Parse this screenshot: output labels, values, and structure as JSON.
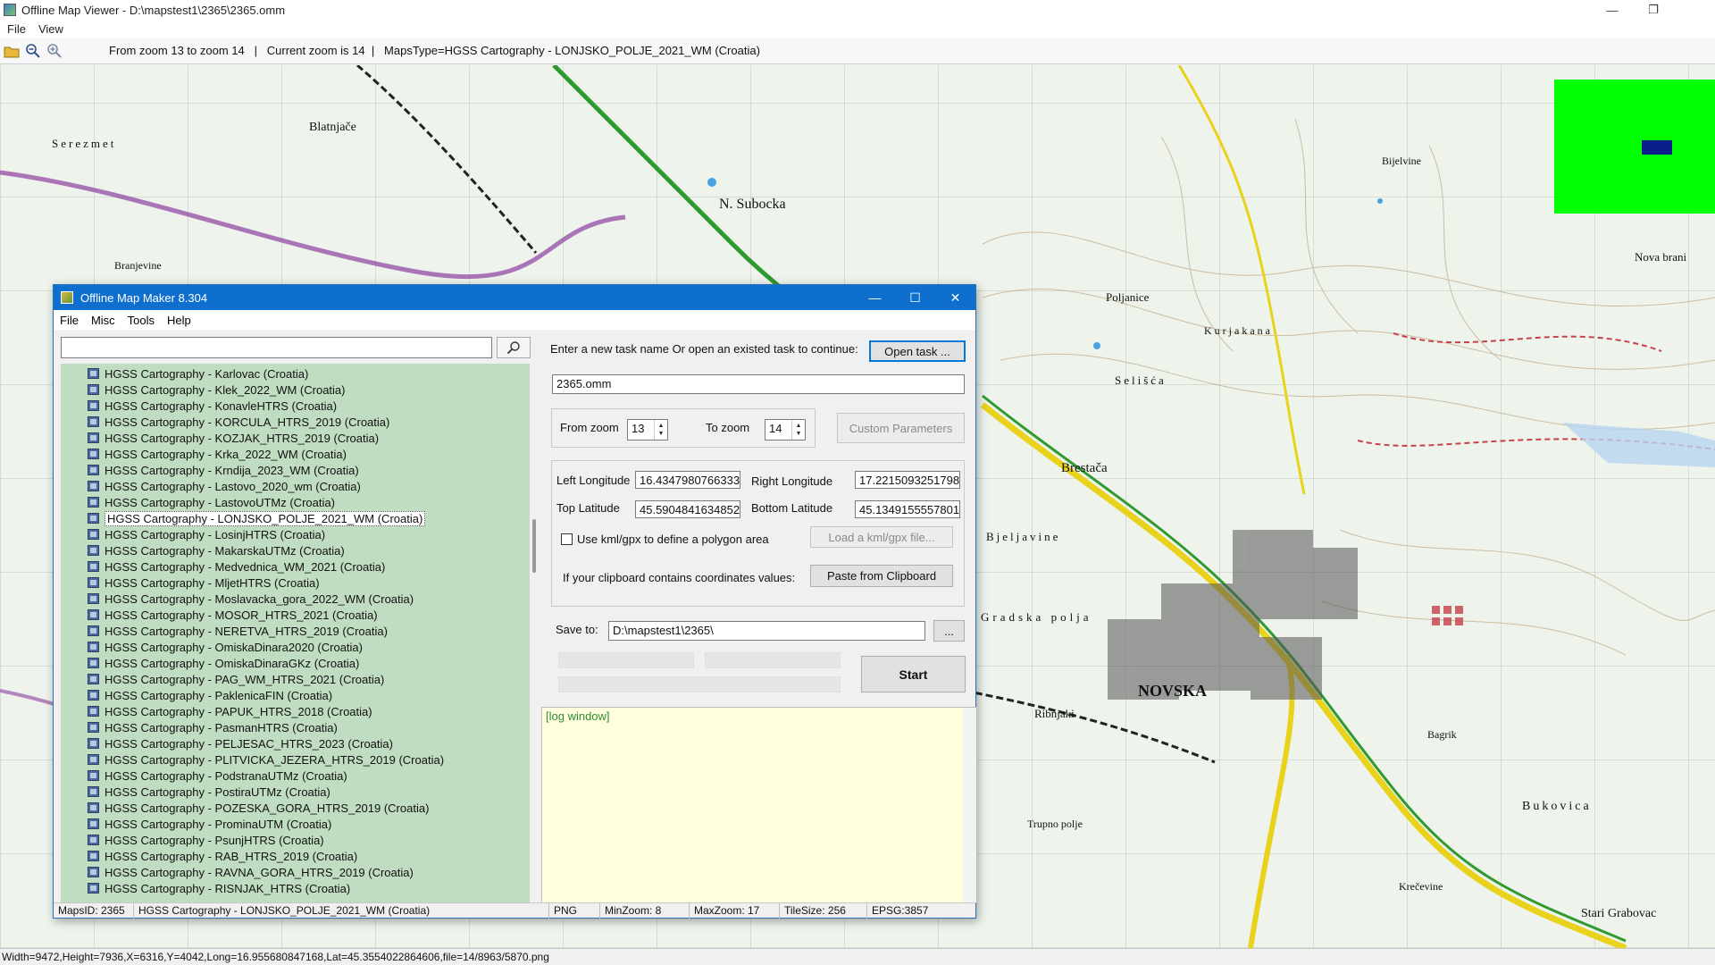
{
  "window": {
    "title": "Offline Map Viewer - D:\\mapstest1\\2365\\2365.omm",
    "controls": [
      "—",
      "❐",
      ""
    ]
  },
  "menu": [
    "File",
    "View"
  ],
  "toolbar": {
    "status": "From zoom 13 to zoom 14   |   Current zoom is 14  |   MapsType=HGSS Cartography - LONJSKO_POLJE_2021_WM (Croatia)"
  },
  "map": {
    "labels": [
      "Serezmet",
      "Blatnjače",
      "N. Subocka",
      "Branjevine",
      "Poljanice",
      "Bijelvine",
      "Brestača",
      "Selišća",
      "Gradska polja",
      "NOVSKA",
      "Bjeljavine",
      "Ribnjaki",
      "Trupno polje",
      "Krečevine",
      "Stari Grabovac",
      "Nova brani",
      "Bagrik",
      "Bukovica",
      "Kurjakana"
    ]
  },
  "dialog": {
    "title": "Offline Map Maker 8.304",
    "controls": [
      "—",
      "☐",
      "✕"
    ],
    "menu": [
      "File",
      "Misc",
      "Tools",
      "Help"
    ],
    "search": {
      "value": ""
    },
    "map_list": [
      "HGSS Cartography - Karlovac (Croatia)",
      "HGSS Cartography - Klek_2022_WM (Croatia)",
      "HGSS Cartography - KonavleHTRS (Croatia)",
      "HGSS Cartography - KORCULA_HTRS_2019 (Croatia)",
      "HGSS Cartography - KOZJAK_HTRS_2019 (Croatia)",
      "HGSS Cartography - Krka_2022_WM (Croatia)",
      "HGSS Cartography - Krndija_2023_WM (Croatia)",
      "HGSS Cartography - Lastovo_2020_wm (Croatia)",
      "HGSS Cartography - LastovoUTMz (Croatia)",
      "HGSS Cartography - LONJSKO_POLJE_2021_WM (Croatia)",
      "HGSS Cartography - LosinjHTRS (Croatia)",
      "HGSS Cartography - MakarskaUTMz (Croatia)",
      "HGSS Cartography - Medvednica_WM_2021 (Croatia)",
      "HGSS Cartography - MljetHTRS (Croatia)",
      "HGSS Cartography - Moslavacka_gora_2022_WM (Croatia)",
      "HGSS Cartography - MOSOR_HTRS_2021 (Croatia)",
      "HGSS Cartography - NERETVA_HTRS_2019 (Croatia)",
      "HGSS Cartography - OmiskaDinara2020 (Croatia)",
      "HGSS Cartography - OmiskaDinaraGKz (Croatia)",
      "HGSS Cartography - PAG_WM_HTRS_2021 (Croatia)",
      "HGSS Cartography - PaklenicaFIN (Croatia)",
      "HGSS Cartography - PAPUK_HTRS_2018 (Croatia)",
      "HGSS Cartography - PasmanHTRS (Croatia)",
      "HGSS Cartography - PELJESAC_HTRS_2023 (Croatia)",
      "HGSS Cartography - PLITVICKA_JEZERA_HTRS_2019 (Croatia)",
      "HGSS Cartography - PodstranaUTMz (Croatia)",
      "HGSS Cartography - PostiraUTMz (Croatia)",
      "HGSS Cartography - POZESKA_GORA_HTRS_2019 (Croatia)",
      "HGSS Cartography - ProminaUTM (Croatia)",
      "HGSS Cartography - PsunjHTRS (Croatia)",
      "HGSS Cartography - RAB_HTRS_2019 (Croatia)",
      "HGSS Cartography - RAVNA_GORA_HTRS_2019 (Croatia)",
      "HGSS Cartography - RISNJAK_HTRS (Croatia)"
    ],
    "selected_index": 9,
    "task_prompt": "Enter a new task name Or open an existed task to continue:",
    "open_task_label": "Open task ...",
    "task_name": "2365.omm",
    "from_zoom_label": "From zoom",
    "from_zoom": "13",
    "to_zoom_label": "To zoom",
    "to_zoom": "14",
    "custom_params_label": "Custom Parameters",
    "left_lon_label": "Left Longitude",
    "left_lon": "16.4347980766333",
    "right_lon_label": "Right Longitude",
    "right_lon": "17.2215093251798",
    "top_lat_label": "Top Latitude",
    "top_lat": "45.5904841634852",
    "bottom_lat_label": "Bottom Latitude",
    "bottom_lat": "45.1349155557801",
    "kml_label": "Use kml/gpx to define a polygon area",
    "load_kml_label": "Load a kml/gpx file...",
    "clipboard_prompt": "If your clipboard contains coordinates values:",
    "paste_label": "Paste from Clipboard",
    "save_to_label": "Save to:",
    "save_to": "D:\\mapstest1\\2365\\",
    "browse_label": "...",
    "start_label": "Start",
    "log_text": "[log window]",
    "status": {
      "maps_id": "MapsID: 2365",
      "maps_name": "HGSS Cartography - LONJSKO_POLJE_2021_WM (Croatia)",
      "format": "PNG",
      "min_zoom": "MinZoom: 8",
      "max_zoom": "MaxZoom: 17",
      "tile_size": "TileSize: 256",
      "epsg": "EPSG:3857"
    }
  },
  "bottom_status": "Width=9472,Height=7936,X=6316,Y=4042,Long=16.955680847168,Lat=45.3554022864606,file=14/8963/5870.png",
  "colors": {
    "dialog_title_bg": "#0f6fcf",
    "list_bg": "#c1ddc1",
    "log_bg": "#ffffe0",
    "minimap_bg": "#00ff00",
    "minimap_view": "#0a1e8c",
    "road_yellow": "#e8d21c",
    "road_green": "#2f9a2f",
    "boundary_purple": "#8b3fa0",
    "contour_brown": "#b79a72"
  }
}
